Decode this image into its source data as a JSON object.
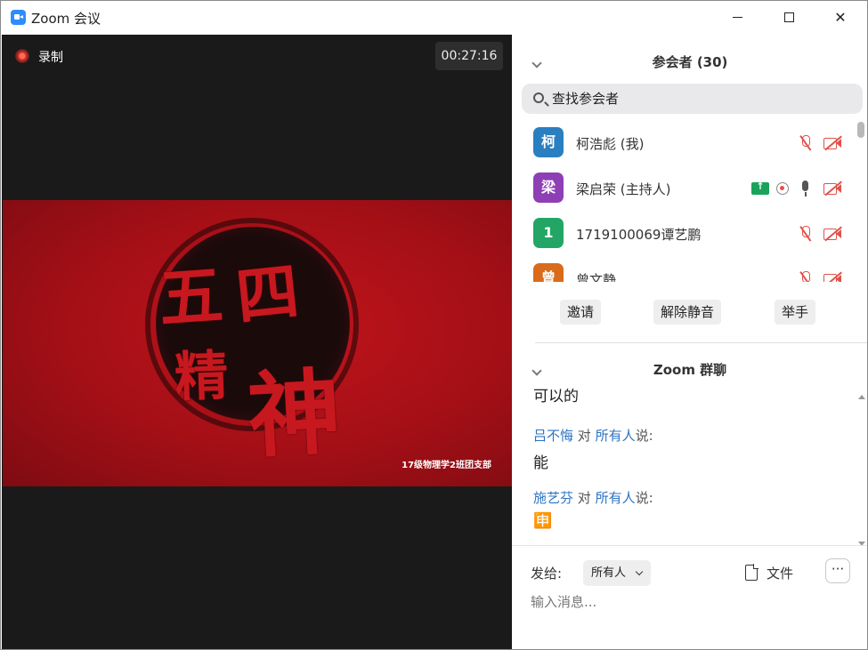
{
  "window": {
    "title": "Zoom 会议"
  },
  "video": {
    "record_label": "录制",
    "timer": "00:27:16",
    "poster": {
      "characters": [
        "五",
        "四",
        "精",
        "神"
      ],
      "caption": "17级物理学2班团支部"
    }
  },
  "participants": {
    "header": "参会者 (30)",
    "search_placeholder": "查找参会者",
    "list": [
      {
        "avatar": "柯",
        "avatar_color": "#2a7fc0",
        "name": "柯浩彪 (我)"
      },
      {
        "avatar": "梁",
        "avatar_color": "#8e3fb5",
        "name": "梁启荣 (主持人)"
      },
      {
        "avatar": "1",
        "avatar_color": "#23a566",
        "name": "1719100069谭艺鹏"
      },
      {
        "avatar": "曾",
        "avatar_color": "#d96b1a",
        "name": "曾文静"
      }
    ],
    "actions": {
      "invite": "邀请",
      "unmute": "解除静音",
      "raise_hand": "举手"
    }
  },
  "chat": {
    "header": "Zoom 群聊",
    "partial_message": "可以的",
    "messages": [
      {
        "sender": "吕不悔",
        "to_word": "对",
        "recipient": "所有人",
        "said": "说:",
        "text": "能"
      },
      {
        "sender": "施艺芬",
        "to_word": "对",
        "recipient": "所有人",
        "said": "说:",
        "text": "🈸"
      }
    ],
    "send_to_label": "发给:",
    "send_to_value": "所有人",
    "file_label": "文件",
    "more_label": "···",
    "input_placeholder": "输入消息..."
  },
  "colors": {
    "accent": "#2d8cff",
    "muted_red": "#e0524a",
    "share_green": "#1aa35a",
    "link_blue": "#2d74c4"
  }
}
